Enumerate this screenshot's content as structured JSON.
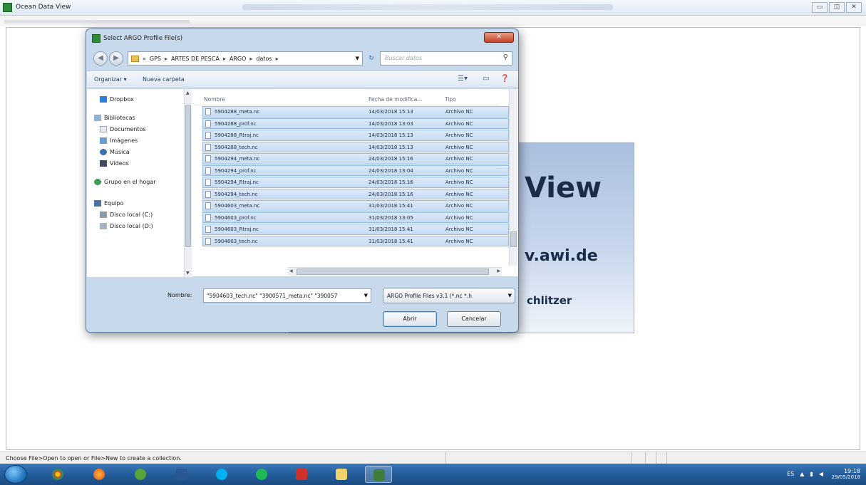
{
  "app": {
    "title": "Ocean Data View",
    "window_buttons": [
      "▭",
      "◫",
      "✕"
    ]
  },
  "splash": {
    "title_fragment": "View",
    "url_fragment": "v.awi.de",
    "author_fragment": "chlitzer"
  },
  "dialog": {
    "title": "Select ARGO Profile File(s)",
    "close_label": "✕",
    "back_label": "◀",
    "forward_label": "▶",
    "breadcrumb": [
      "«",
      "GPS",
      "ARTES DE PESCA",
      "ARGO",
      "datos"
    ],
    "breadcrumb_sep": "▸",
    "search_placeholder": "Buscar datos",
    "toolbar": {
      "organize": "Organizar ▾",
      "new_folder": "Nueva carpeta"
    },
    "nav": {
      "dropbox": "Dropbox",
      "libraries": "Bibliotecas",
      "documents": "Documentos",
      "images": "Imágenes",
      "music": "Música",
      "videos": "Vídeos",
      "homegroup": "Grupo en el hogar",
      "computer": "Equipo",
      "local_c": "Disco local (C:)",
      "local_d": "Disco local (D:)"
    },
    "columns": {
      "name": "Nombre",
      "date": "Fecha de modifica...",
      "type": "Tipo"
    },
    "files": [
      {
        "name": "5904288_meta.nc",
        "date": "14/03/2018 15:13",
        "type": "Archivo NC"
      },
      {
        "name": "5904288_prof.nc",
        "date": "14/03/2018 13:03",
        "type": "Archivo NC"
      },
      {
        "name": "5904288_Rtraj.nc",
        "date": "14/03/2018 15:13",
        "type": "Archivo NC"
      },
      {
        "name": "5904288_tech.nc",
        "date": "14/03/2018 15:13",
        "type": "Archivo NC"
      },
      {
        "name": "5904294_meta.nc",
        "date": "24/03/2018 15:16",
        "type": "Archivo NC"
      },
      {
        "name": "5904294_prof.nc",
        "date": "24/03/2018 13:04",
        "type": "Archivo NC"
      },
      {
        "name": "5904294_Rtraj.nc",
        "date": "24/03/2018 15:16",
        "type": "Archivo NC"
      },
      {
        "name": "5904294_tech.nc",
        "date": "24/03/2018 15:16",
        "type": "Archivo NC"
      },
      {
        "name": "5904603_meta.nc",
        "date": "31/03/2018 15:41",
        "type": "Archivo NC"
      },
      {
        "name": "5904603_prof.nc",
        "date": "31/03/2018 13:05",
        "type": "Archivo NC"
      },
      {
        "name": "5904603_Rtraj.nc",
        "date": "31/03/2018 15:41",
        "type": "Archivo NC"
      },
      {
        "name": "5904603_tech.nc",
        "date": "31/03/2018 15:41",
        "type": "Archivo NC"
      }
    ],
    "filename_label": "Nombre:",
    "filename_value": "\"5904603_tech.nc\" \"3900571_meta.nc\" \"390057",
    "filetype_value": "ARGO Profile Files v3.1 (*.nc *.h",
    "open_button": "Abrir",
    "cancel_button": "Cancelar"
  },
  "status": {
    "message": "Choose File>Open to open or File>New to create a collection."
  },
  "taskbar": {
    "time": "19:18",
    "date": "29/05/2018",
    "lang": "ES"
  }
}
